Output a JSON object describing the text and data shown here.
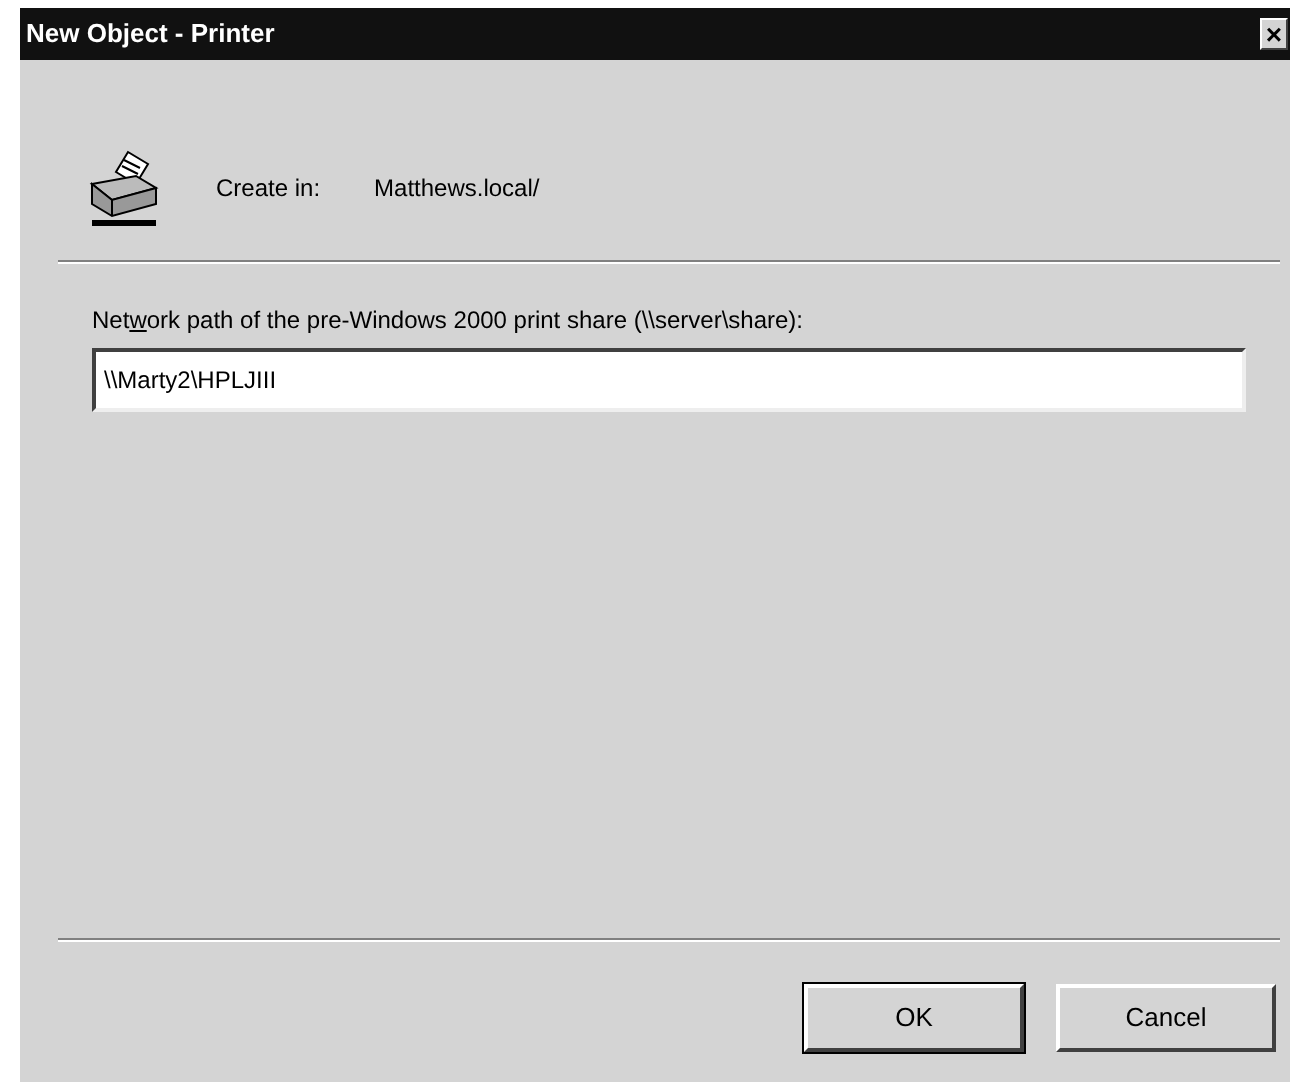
{
  "window": {
    "title": "New Object - Printer",
    "close_button": "×"
  },
  "create_in": {
    "label": "Create in:",
    "value": "Matthews.local/"
  },
  "path_field": {
    "label": {
      "before": "Net",
      "access_key": "w",
      "after": "ork path of the pre-Windows 2000 print share (\\\\server\\share):"
    },
    "value": "\\\\Marty2\\HPLJIII"
  },
  "buttons": [
    {
      "label": "OK",
      "default": true
    },
    {
      "label": "Cancel",
      "default": false
    }
  ]
}
